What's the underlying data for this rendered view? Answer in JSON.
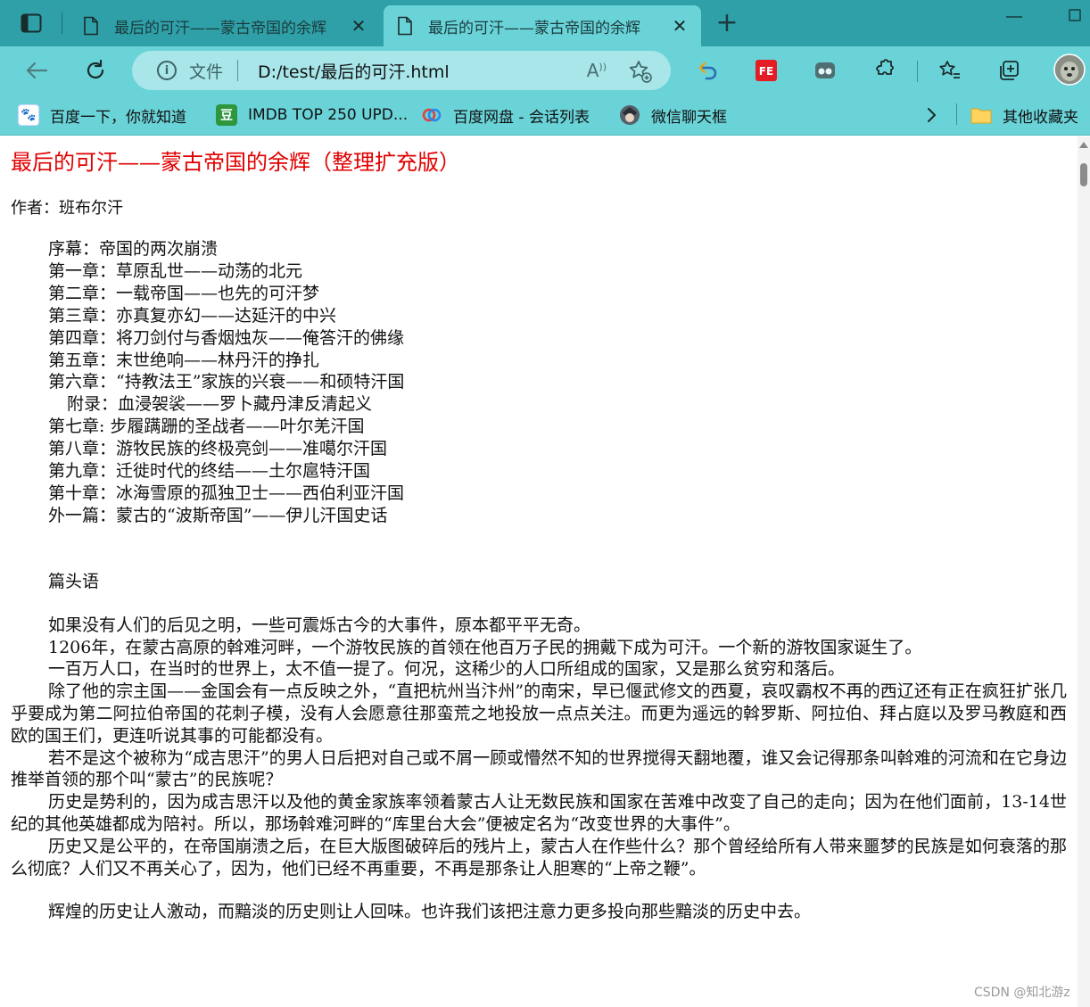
{
  "tabs": [
    {
      "title": "最后的可汗——蒙古帝国的余辉",
      "active": false
    },
    {
      "title": "最后的可汗——蒙古帝国的余辉",
      "active": true
    }
  ],
  "addressbar": {
    "scheme_label": "文件",
    "url": "D:/test/最后的可汗.html"
  },
  "favorites": [
    {
      "label": "百度一下，你就知道",
      "icon": "baidu-paw-icon"
    },
    {
      "label": "IMDB TOP 250 UPD...",
      "icon": "douban-icon"
    },
    {
      "label": "百度网盘 - 会话列表",
      "icon": "baidu-netdisk-icon"
    },
    {
      "label": "微信聊天框",
      "icon": "avatar-icon"
    }
  ],
  "other_favorites": "其他收藏夹",
  "document": {
    "title": "最后的可汗——蒙古帝国的余辉（整理扩充版）",
    "author": "作者：班布尔汗",
    "toc": [
      "序幕：帝国的两次崩溃",
      "第一章：草原乱世——动荡的北元",
      "第二章：一载帝国——也先的可汗梦",
      "第三章：亦真复亦幻——达延汗的中兴",
      "第四章：将刀剑付与香烟烛灰——俺答汗的佛缘",
      "第五章：末世绝响——林丹汗的挣扎",
      "第六章：“持教法王”家族的兴衰——和硕特汗国",
      "附录：血浸袈裟——罗卜藏丹津反清起义",
      "第七章: 步履蹒跚的圣战者——叶尔羌汗国",
      "第八章：游牧民族的终极亮剑——准噶尔汗国",
      "第九章：迁徙时代的终结——土尔扈特汗国",
      "第十章：冰海雪原的孤独卫士——西伯利亚汗国",
      "外一篇：蒙古的“波斯帝国”——伊儿汗国史话"
    ],
    "section_heading": "篇头语",
    "paragraphs": [
      "如果没有人们的后见之明，一些可震烁古今的大事件，原本都平平无奇。",
      "1206年，在蒙古高原的斡难河畔，一个游牧民族的首领在他百万子民的拥戴下成为可汗。一个新的游牧国家诞生了。",
      "一百万人口，在当时的世界上，太不值一提了。何况，这稀少的人口所组成的国家，又是那么贫穷和落后。",
      "除了他的宗主国——金国会有一点反映之外，“直把杭州当汴州”的南宋，早已偃武修文的西夏，哀叹霸权不再的西辽还有正在疯狂扩张几乎要成为第二阿拉伯帝国的花刺子模，没有人会愿意往那蛮荒之地投放一点点关注。而更为遥远的斡罗斯、阿拉伯、拜占庭以及罗马教庭和西欧的国王们，更连听说其事的可能都没有。",
      "若不是这个被称为“成吉思汗”的男人日后把对自己或不屑一顾或懵然不知的世界搅得天翻地覆，谁又会记得那条叫斡难的河流和在它身边推举首领的那个叫“蒙古”的民族呢？",
      "历史是势利的，因为成吉思汗以及他的黄金家族率领着蒙古人让无数民族和国家在苦难中改变了自己的走向；因为在他们面前，13-14世纪的其他英雄都成为陪衬。所以，那场斡难河畔的“库里台大会”便被定名为“改变世界的大事件”。",
      "历史又是公平的，在帝国崩溃之后，在巨大版图破碎后的残片上，蒙古人在作些什么？那个曾经给所有人带来噩梦的民族是如何衰落的那么彻底？人们又不再关心了，因为，他们已经不再重要，不再是那条让人胆寒的“上帝之鞭”。",
      "辉煌的历史让人激动，而黯淡的历史则让人回味。也许我们该把注意力更多投向那些黯淡的历史中去。"
    ]
  },
  "watermark": "CSDN @知北游z"
}
